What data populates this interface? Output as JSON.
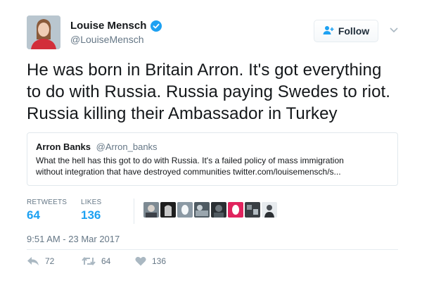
{
  "author": {
    "display_name": "Louise Mensch",
    "handle": "@LouiseMensch",
    "verified_icon": "verified-badge-icon"
  },
  "follow_button": {
    "label": "Follow",
    "icon": "add-user-icon"
  },
  "tweet": {
    "text_lines": [
      "He was born in Britain Arron. It's got everything",
      "to do with Russia. Russia paying Swedes to riot.",
      "Russia killing their Ambassador in Turkey"
    ]
  },
  "quoted_tweet": {
    "name": "Arron Banks",
    "handle": "@Arron_banks",
    "text_lines": [
      "What the hell has this got to do with Russia. It's a failed policy of mass immigration",
      "without integration that have destroyed communities twitter.com/louisemensch/s..."
    ]
  },
  "stats": {
    "retweets_label": "RETWEETS",
    "retweets_value": "64",
    "likes_label": "LIKES",
    "likes_value": "136"
  },
  "timestamp": "9:51 AM - 23 Mar 2017",
  "actions": {
    "reply_count": "72",
    "retweet_count": "64",
    "like_count": "136"
  },
  "colors": {
    "accent": "#1da1f2",
    "secondary_text": "#657786",
    "border": "#e1e8ed"
  }
}
